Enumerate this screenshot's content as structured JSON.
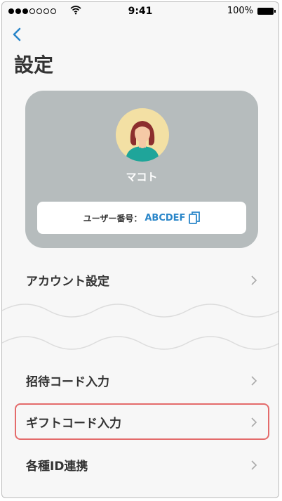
{
  "status_bar": {
    "time": "9:41",
    "battery": "100%"
  },
  "page": {
    "title": "設定"
  },
  "profile": {
    "name": "マコト",
    "user_id_label": "ユーザー番号：",
    "user_id_value": "ABCDEF"
  },
  "menu": [
    {
      "label": "アカウント設定"
    },
    {
      "label": "招待コード入力"
    },
    {
      "label": "ギフトコード入力",
      "highlighted": true
    },
    {
      "label": "各種ID連携"
    }
  ],
  "colors": {
    "accent": "#2a86c9",
    "card_background": "#b6bcbd",
    "highlight_border": "#e46b6b"
  }
}
